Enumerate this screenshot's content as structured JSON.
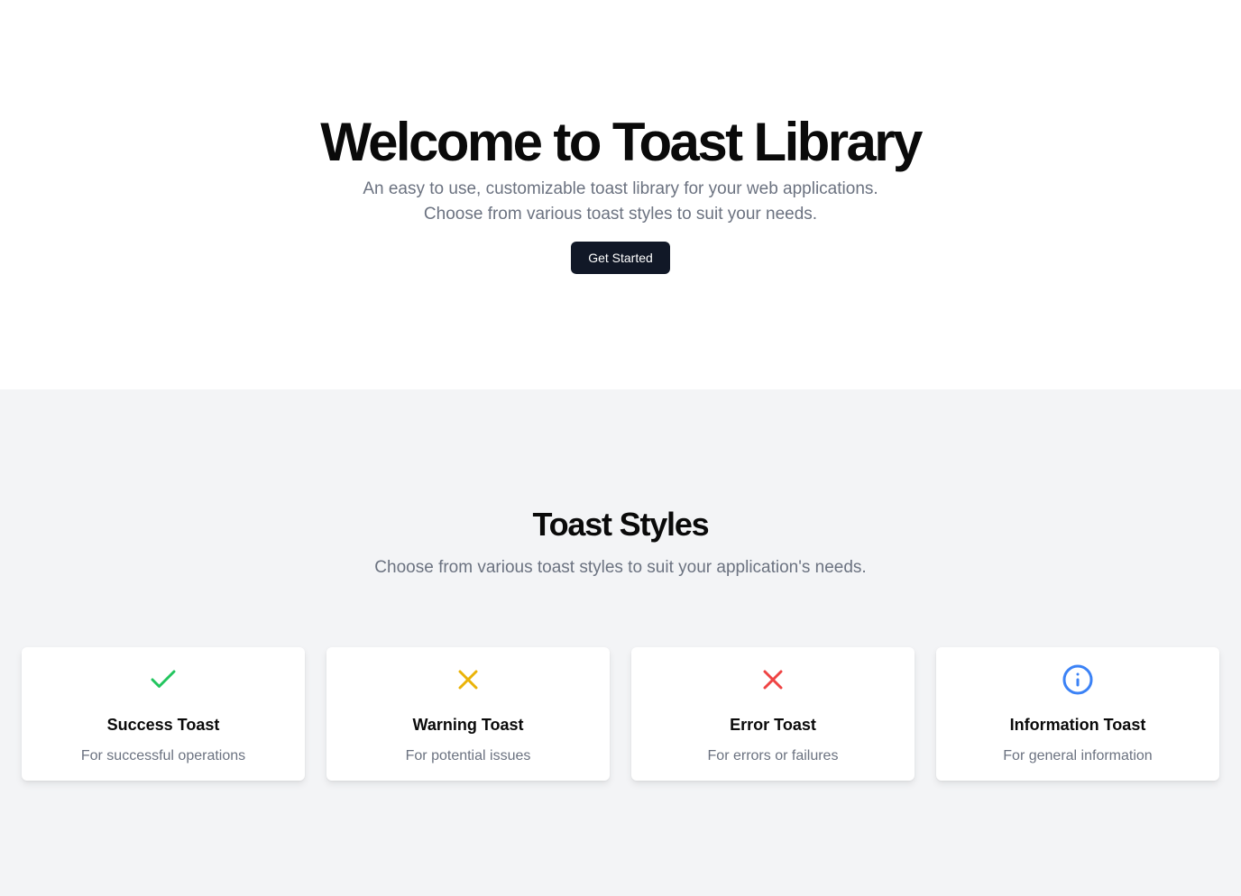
{
  "hero": {
    "title": "Welcome to Toast Library",
    "subtitle_line1": "An easy to use, customizable toast library for your web applications.",
    "subtitle_line2": "Choose from various toast styles to suit your needs.",
    "cta_label": "Get Started"
  },
  "styles": {
    "title": "Toast Styles",
    "subtitle": "Choose from various toast styles to suit your application's needs.",
    "cards": [
      {
        "icon": "check-icon",
        "color": "#22c55e",
        "title": "Success Toast",
        "description": "For successful operations"
      },
      {
        "icon": "x-icon",
        "color": "#eab308",
        "title": "Warning Toast",
        "description": "For potential issues"
      },
      {
        "icon": "x-icon",
        "color": "#ef4444",
        "title": "Error Toast",
        "description": "For errors or failures"
      },
      {
        "icon": "info-circle-icon",
        "color": "#3b82f6",
        "title": "Information Toast",
        "description": "For general information"
      }
    ]
  },
  "colors": {
    "button_bg": "#111827",
    "section_bg": "#f3f4f6",
    "muted_text": "#6b7280"
  }
}
